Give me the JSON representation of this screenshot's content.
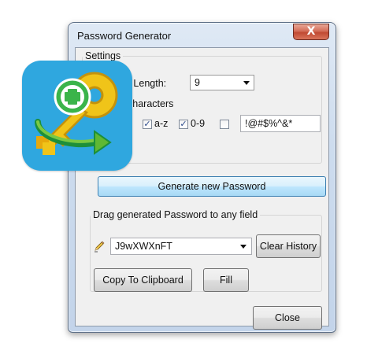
{
  "window": {
    "title": "Password Generator",
    "close_glyph": "X"
  },
  "settings": {
    "legend": "Settings",
    "length_label": "d Length:",
    "length_value": "9",
    "characters_label": "characters",
    "lowercase_label": "a-z",
    "lowercase_checked": true,
    "digits_label": "0-9",
    "digits_checked": true,
    "special_checked": false,
    "special_chars_value": "!@#$%^&*",
    "generate_button": "Generate new Password"
  },
  "history": {
    "legend": "Drag generated Password to any field",
    "password_value": "J9wXWXnFT",
    "clear_button": "Clear History",
    "copy_button": "Copy To Clipboard",
    "fill_button": "Fill",
    "pencil_icon": "pencil-icon"
  },
  "footer": {
    "close_button": "Close"
  },
  "overlay": {
    "app_icon": "key-plus-app-icon"
  },
  "colors": {
    "app_icon_bg": "#2fa7df",
    "close_button_red": "#c04a33",
    "primary_button_blue": "#bee6fd"
  }
}
